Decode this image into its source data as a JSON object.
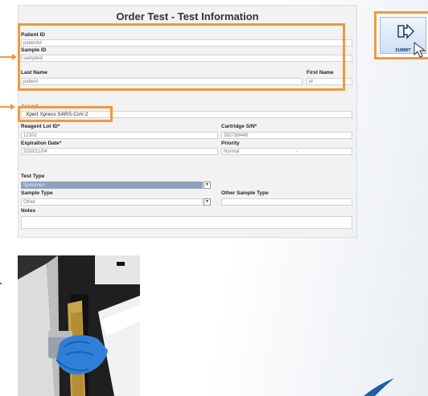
{
  "form": {
    "title": "Order Test - Test Information",
    "patient_id": {
      "label": "Patient ID",
      "value": "patientid"
    },
    "sample_id": {
      "label": "Sample ID",
      "value": "sampleid"
    },
    "last_name": {
      "label": "Last Name",
      "value": "patient"
    },
    "first_name": {
      "label": "First Name",
      "value": "id"
    },
    "assay": {
      "label": "Assay*",
      "value": "Xpert Xpress SARS-CoV-2"
    },
    "reagent_lot": {
      "label": "Reagent Lot ID*",
      "value": "12102"
    },
    "cartridge_sn": {
      "label": "Cartridge S/N*",
      "value": "282769448"
    },
    "expiration": {
      "label": "Expiration Date*",
      "value": "2018/11/04"
    },
    "priority": {
      "label": "Priority",
      "value": "Normal",
      "extra": "-"
    },
    "test_type": {
      "label": "Test Type",
      "value": "Specimen"
    },
    "sample_type": {
      "label": "Sample Type",
      "value": "Other"
    },
    "other_sample_type": {
      "label": "Other Sample Type",
      "value": ""
    },
    "notes": {
      "label": "Notes",
      "value": ""
    }
  },
  "submit": {
    "label": "SUBMIT",
    "icon": "submit-arrow-icon"
  },
  "colors": {
    "highlight": "#ef9a3c",
    "selected": "#8ea1bd",
    "form_bg": "#f2f2f2"
  }
}
